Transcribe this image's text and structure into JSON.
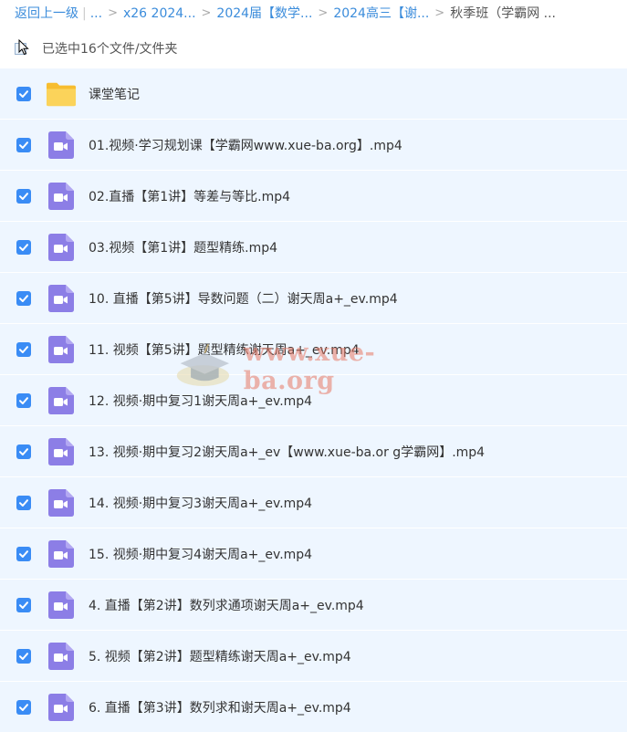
{
  "breadcrumb": {
    "back": "返回上一级",
    "ellipsis": "...",
    "items": [
      "x26 2024...",
      "2024届【数学...",
      "2024高三【谢..."
    ],
    "current": "秋季班（学霸网 ..."
  },
  "selection": {
    "label": "已选中16个文件/文件夹"
  },
  "files": [
    {
      "name": "课堂笔记",
      "type": "folder"
    },
    {
      "name": "01.视频·学习规划课【学霸网www.xue-ba.org】.mp4",
      "type": "video"
    },
    {
      "name": "02.直播【第1讲】等差与等比.mp4",
      "type": "video"
    },
    {
      "name": "03.视频【第1讲】题型精练.mp4",
      "type": "video"
    },
    {
      "name": "10. 直播【第5讲】导数问题（二）谢天周a+_ev.mp4",
      "type": "video"
    },
    {
      "name": "11. 视频【第5讲】题型精练谢天周a+_ev.mp4",
      "type": "video"
    },
    {
      "name": "12. 视频·期中复习1谢天周a+_ev.mp4",
      "type": "video"
    },
    {
      "name": "13. 视频·期中复习2谢天周a+_ev【www.xue-ba.or g学霸网】.mp4",
      "type": "video"
    },
    {
      "name": "14. 视频·期中复习3谢天周a+_ev.mp4",
      "type": "video"
    },
    {
      "name": "15. 视频·期中复习4谢天周a+_ev.mp4",
      "type": "video"
    },
    {
      "name": "4. 直播【第2讲】数列求通项谢天周a+_ev.mp4",
      "type": "video"
    },
    {
      "name": "5. 视频【第2讲】题型精练谢天周a+_ev.mp4",
      "type": "video"
    },
    {
      "name": "6. 直播【第3讲】数列求和谢天周a+_ev.mp4",
      "type": "video"
    }
  ],
  "watermark": {
    "text": "www.xue-ba.org"
  },
  "colors": {
    "accent": "#3a8cf5",
    "row_bg": "#eef6ff",
    "video_icon": "#8c7ee6",
    "folder": "#f9c947"
  }
}
